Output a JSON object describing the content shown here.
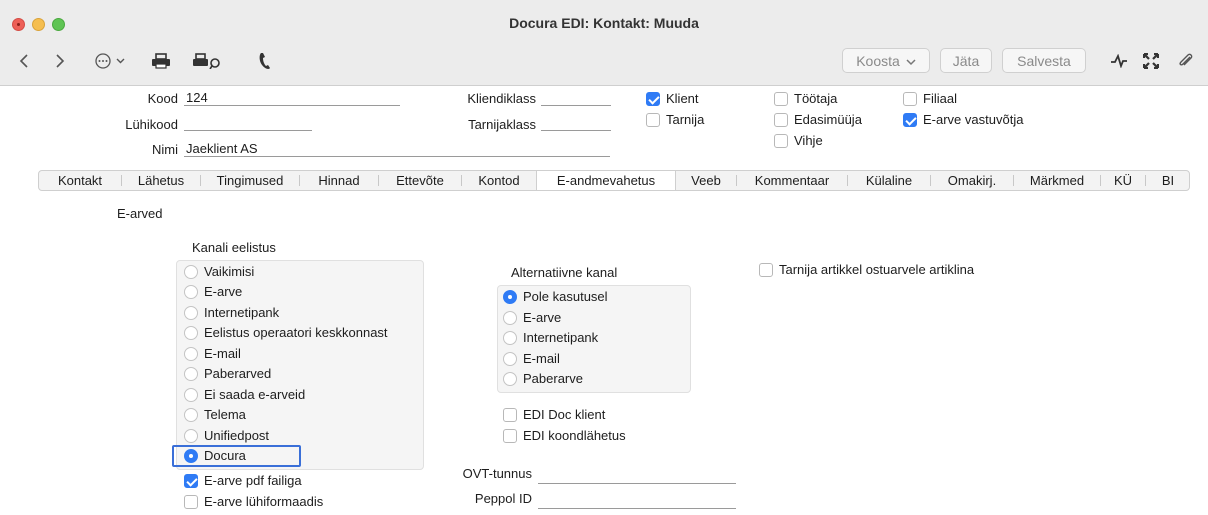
{
  "window": {
    "title": "Docura EDI: Kontakt: Muuda"
  },
  "toolbar": {
    "koosta": "Koosta",
    "jata": "Jäta",
    "salvesta": "Salvesta"
  },
  "header": {
    "kood_label": "Kood",
    "kood_value": "124",
    "luhikood_label": "Lühikood",
    "luhikood_value": "",
    "nimi_label": "Nimi",
    "nimi_value": "Jaeklient AS",
    "kliendiklass_label": "Kliendiklass",
    "kliendiklass_value": "",
    "tarnijaklass_label": "Tarnijaklass",
    "tarnijaklass_value": "",
    "checks": [
      {
        "label": "Klient",
        "checked": true
      },
      {
        "label": "Tarnija",
        "checked": false
      },
      {
        "label": "Töötaja",
        "checked": false
      },
      {
        "label": "Edasimüüja",
        "checked": false
      },
      {
        "label": "Vihje",
        "checked": false
      },
      {
        "label": "Filiaal",
        "checked": false
      },
      {
        "label": "E-arve vastuvõtja",
        "checked": true
      }
    ]
  },
  "tabs": [
    {
      "label": "Kontakt"
    },
    {
      "label": "Lähetus"
    },
    {
      "label": "Tingimused"
    },
    {
      "label": "Hinnad"
    },
    {
      "label": "Ettevõte"
    },
    {
      "label": "Kontod"
    },
    {
      "label": "E-andmevahetus",
      "active": true
    },
    {
      "label": "Veeb"
    },
    {
      "label": "Kommentaar"
    },
    {
      "label": "Külaline"
    },
    {
      "label": "Omakirj."
    },
    {
      "label": "Märkmed"
    },
    {
      "label": "KÜ"
    },
    {
      "label": "BI"
    }
  ],
  "section": {
    "title": "E-arved",
    "kanali_label": "Kanali eelistus",
    "kanali_options": [
      {
        "label": "Vaikimisi",
        "selected": false
      },
      {
        "label": "E-arve",
        "selected": false
      },
      {
        "label": "Internetipank",
        "selected": false
      },
      {
        "label": "Eelistus operaatori keskkonnast",
        "selected": false
      },
      {
        "label": "E-mail",
        "selected": false
      },
      {
        "label": "Paberarved",
        "selected": false
      },
      {
        "label": "Ei saada e-arveid",
        "selected": false
      },
      {
        "label": "Telema",
        "selected": false
      },
      {
        "label": "Unifiedpost",
        "selected": false
      },
      {
        "label": "Docura",
        "selected": true
      }
    ],
    "pdf_label": "E-arve pdf failiga",
    "pdf_checked": true,
    "luhiformaat_label": "E-arve lühiformaadis",
    "luhiformaat_checked": false,
    "alt_label": "Alternatiivne kanal",
    "alt_options": [
      {
        "label": "Pole kasutusel",
        "selected": true
      },
      {
        "label": "E-arve",
        "selected": false
      },
      {
        "label": "Internetipank",
        "selected": false
      },
      {
        "label": "E-mail",
        "selected": false
      },
      {
        "label": "Paberarve",
        "selected": false
      }
    ],
    "edi_doc_label": "EDI Doc klient",
    "edi_doc_checked": false,
    "edi_koond_label": "EDI koondlähetus",
    "edi_koond_checked": false,
    "ovt_label": "OVT-tunnus",
    "ovt_value": "",
    "peppol_label": "Peppol ID",
    "peppol_value": "",
    "tarnija_artikkel_label": "Tarnija artikkel ostuarvele artiklina",
    "tarnija_artikkel_checked": false
  }
}
